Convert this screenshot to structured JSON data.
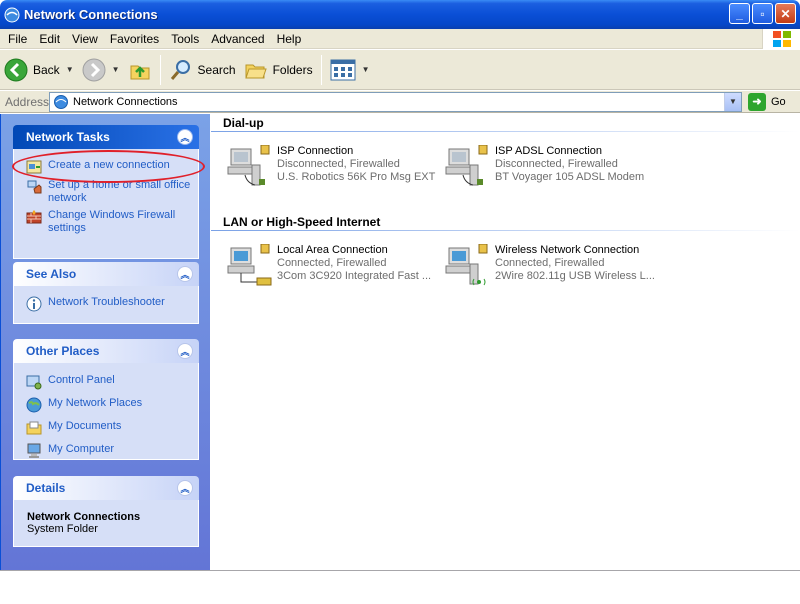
{
  "window": {
    "title": "Network Connections"
  },
  "menu": [
    "File",
    "Edit",
    "View",
    "Favorites",
    "Tools",
    "Advanced",
    "Help"
  ],
  "toolbar": {
    "back": "Back",
    "search": "Search",
    "folders": "Folders"
  },
  "address": {
    "label": "Address",
    "value": "Network Connections",
    "go": "Go"
  },
  "network_tasks": {
    "title": "Network Tasks",
    "items": [
      {
        "label": "Create a new connection",
        "icon": "new-connection-icon"
      },
      {
        "label": "Set up a home or small office network",
        "icon": "home-network-icon"
      },
      {
        "label": "Change Windows Firewall settings",
        "icon": "firewall-icon"
      }
    ]
  },
  "see_also": {
    "title": "See Also",
    "items": [
      {
        "label": "Network Troubleshooter",
        "icon": "info-icon"
      }
    ]
  },
  "other_places": {
    "title": "Other Places",
    "items": [
      {
        "label": "Control Panel",
        "icon": "control-panel-icon"
      },
      {
        "label": "My Network Places",
        "icon": "network-places-icon"
      },
      {
        "label": "My Documents",
        "icon": "documents-icon"
      },
      {
        "label": "My Computer",
        "icon": "computer-icon"
      }
    ]
  },
  "details": {
    "title": "Details",
    "name": "Network Connections",
    "type": "System Folder"
  },
  "groups": [
    {
      "title": "Dial-up",
      "connections": [
        {
          "name": "ISP Connection",
          "status": "Disconnected, Firewalled",
          "device": "U.S. Robotics 56K Pro Msg EXT"
        },
        {
          "name": "ISP ADSL Connection",
          "status": "Disconnected, Firewalled",
          "device": "BT Voyager 105 ADSL Modem"
        }
      ]
    },
    {
      "title": "LAN or High-Speed Internet",
      "connections": [
        {
          "name": "Local Area Connection",
          "status": "Connected, Firewalled",
          "device": "3Com 3C920 Integrated Fast ..."
        },
        {
          "name": "Wireless Network Connection",
          "status": "Connected, Firewalled",
          "device": "2Wire 802.11g USB Wireless L..."
        }
      ]
    }
  ]
}
